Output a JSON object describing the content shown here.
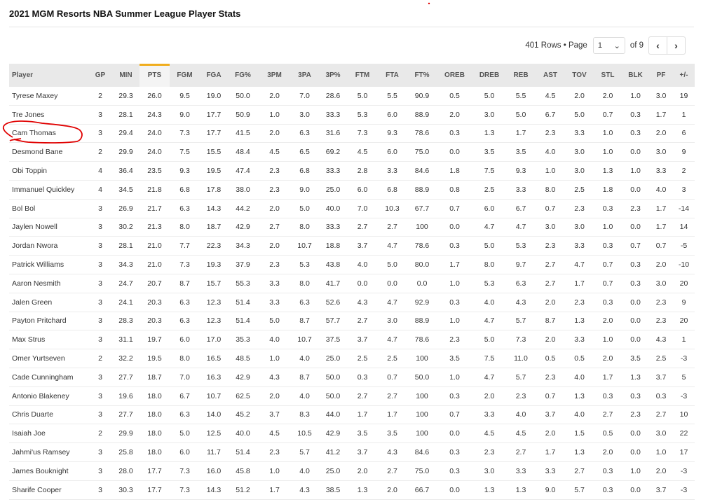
{
  "title": "2021 MGM Resorts NBA Summer League Player Stats",
  "pager": {
    "rows_label": "401 Rows • Page",
    "page": "1",
    "of_label": "of 9",
    "prev_icon": "chevron-left-icon",
    "next_icon": "chevron-right-icon"
  },
  "table": {
    "sorted_column": "PTS",
    "sort_color": "#f0ad1e",
    "highlight_color": "#e00000",
    "highlighted_player": "Cam Thomas",
    "columns": [
      "Player",
      "GP",
      "MIN",
      "PTS",
      "FGM",
      "FGA",
      "FG%",
      "3PM",
      "3PA",
      "3P%",
      "FTM",
      "FTA",
      "FT%",
      "OREB",
      "DREB",
      "REB",
      "AST",
      "TOV",
      "STL",
      "BLK",
      "PF",
      "+/-"
    ],
    "rows": [
      [
        "Tyrese Maxey",
        "2",
        "29.3",
        "26.0",
        "9.5",
        "19.0",
        "50.0",
        "2.0",
        "7.0",
        "28.6",
        "5.0",
        "5.5",
        "90.9",
        "0.5",
        "5.0",
        "5.5",
        "4.5",
        "2.0",
        "2.0",
        "1.0",
        "3.0",
        "19"
      ],
      [
        "Tre Jones",
        "3",
        "28.1",
        "24.3",
        "9.0",
        "17.7",
        "50.9",
        "1.0",
        "3.0",
        "33.3",
        "5.3",
        "6.0",
        "88.9",
        "2.0",
        "3.0",
        "5.0",
        "6.7",
        "5.0",
        "0.7",
        "0.3",
        "1.7",
        "1"
      ],
      [
        "Cam Thomas",
        "3",
        "29.4",
        "24.0",
        "7.3",
        "17.7",
        "41.5",
        "2.0",
        "6.3",
        "31.6",
        "7.3",
        "9.3",
        "78.6",
        "0.3",
        "1.3",
        "1.7",
        "2.3",
        "3.3",
        "1.0",
        "0.3",
        "2.0",
        "6"
      ],
      [
        "Desmond Bane",
        "2",
        "29.9",
        "24.0",
        "7.5",
        "15.5",
        "48.4",
        "4.5",
        "6.5",
        "69.2",
        "4.5",
        "6.0",
        "75.0",
        "0.0",
        "3.5",
        "3.5",
        "4.0",
        "3.0",
        "1.0",
        "0.0",
        "3.0",
        "9"
      ],
      [
        "Obi Toppin",
        "4",
        "36.4",
        "23.5",
        "9.3",
        "19.5",
        "47.4",
        "2.3",
        "6.8",
        "33.3",
        "2.8",
        "3.3",
        "84.6",
        "1.8",
        "7.5",
        "9.3",
        "1.0",
        "3.0",
        "1.3",
        "1.0",
        "3.3",
        "2"
      ],
      [
        "Immanuel Quickley",
        "4",
        "34.5",
        "21.8",
        "6.8",
        "17.8",
        "38.0",
        "2.3",
        "9.0",
        "25.0",
        "6.0",
        "6.8",
        "88.9",
        "0.8",
        "2.5",
        "3.3",
        "8.0",
        "2.5",
        "1.8",
        "0.0",
        "4.0",
        "3"
      ],
      [
        "Bol Bol",
        "3",
        "26.9",
        "21.7",
        "6.3",
        "14.3",
        "44.2",
        "2.0",
        "5.0",
        "40.0",
        "7.0",
        "10.3",
        "67.7",
        "0.7",
        "6.0",
        "6.7",
        "0.7",
        "2.3",
        "0.3",
        "2.3",
        "1.7",
        "-14"
      ],
      [
        "Jaylen Nowell",
        "3",
        "30.2",
        "21.3",
        "8.0",
        "18.7",
        "42.9",
        "2.7",
        "8.0",
        "33.3",
        "2.7",
        "2.7",
        "100",
        "0.0",
        "4.7",
        "4.7",
        "3.0",
        "3.0",
        "1.0",
        "0.0",
        "1.7",
        "14"
      ],
      [
        "Jordan Nwora",
        "3",
        "28.1",
        "21.0",
        "7.7",
        "22.3",
        "34.3",
        "2.0",
        "10.7",
        "18.8",
        "3.7",
        "4.7",
        "78.6",
        "0.3",
        "5.0",
        "5.3",
        "2.3",
        "3.3",
        "0.3",
        "0.7",
        "0.7",
        "-5"
      ],
      [
        "Patrick Williams",
        "3",
        "34.3",
        "21.0",
        "7.3",
        "19.3",
        "37.9",
        "2.3",
        "5.3",
        "43.8",
        "4.0",
        "5.0",
        "80.0",
        "1.7",
        "8.0",
        "9.7",
        "2.7",
        "4.7",
        "0.7",
        "0.3",
        "2.0",
        "-10"
      ],
      [
        "Aaron Nesmith",
        "3",
        "24.7",
        "20.7",
        "8.7",
        "15.7",
        "55.3",
        "3.3",
        "8.0",
        "41.7",
        "0.0",
        "0.0",
        "0.0",
        "1.0",
        "5.3",
        "6.3",
        "2.7",
        "1.7",
        "0.7",
        "0.3",
        "3.0",
        "20"
      ],
      [
        "Jalen Green",
        "3",
        "24.1",
        "20.3",
        "6.3",
        "12.3",
        "51.4",
        "3.3",
        "6.3",
        "52.6",
        "4.3",
        "4.7",
        "92.9",
        "0.3",
        "4.0",
        "4.3",
        "2.0",
        "2.3",
        "0.3",
        "0.0",
        "2.3",
        "9"
      ],
      [
        "Payton Pritchard",
        "3",
        "28.3",
        "20.3",
        "6.3",
        "12.3",
        "51.4",
        "5.0",
        "8.7",
        "57.7",
        "2.7",
        "3.0",
        "88.9",
        "1.0",
        "4.7",
        "5.7",
        "8.7",
        "1.3",
        "2.0",
        "0.0",
        "2.3",
        "20"
      ],
      [
        "Max Strus",
        "3",
        "31.1",
        "19.7",
        "6.0",
        "17.0",
        "35.3",
        "4.0",
        "10.7",
        "37.5",
        "3.7",
        "4.7",
        "78.6",
        "2.3",
        "5.0",
        "7.3",
        "2.0",
        "3.3",
        "1.0",
        "0.0",
        "4.3",
        "1"
      ],
      [
        "Omer Yurtseven",
        "2",
        "32.2",
        "19.5",
        "8.0",
        "16.5",
        "48.5",
        "1.0",
        "4.0",
        "25.0",
        "2.5",
        "2.5",
        "100",
        "3.5",
        "7.5",
        "11.0",
        "0.5",
        "0.5",
        "2.0",
        "3.5",
        "2.5",
        "-3"
      ],
      [
        "Cade Cunningham",
        "3",
        "27.7",
        "18.7",
        "7.0",
        "16.3",
        "42.9",
        "4.3",
        "8.7",
        "50.0",
        "0.3",
        "0.7",
        "50.0",
        "1.0",
        "4.7",
        "5.7",
        "2.3",
        "4.0",
        "1.7",
        "1.3",
        "3.7",
        "5"
      ],
      [
        "Antonio Blakeney",
        "3",
        "19.6",
        "18.0",
        "6.7",
        "10.7",
        "62.5",
        "2.0",
        "4.0",
        "50.0",
        "2.7",
        "2.7",
        "100",
        "0.3",
        "2.0",
        "2.3",
        "0.7",
        "1.3",
        "0.3",
        "0.3",
        "0.3",
        "-3"
      ],
      [
        "Chris Duarte",
        "3",
        "27.7",
        "18.0",
        "6.3",
        "14.0",
        "45.2",
        "3.7",
        "8.3",
        "44.0",
        "1.7",
        "1.7",
        "100",
        "0.7",
        "3.3",
        "4.0",
        "3.7",
        "4.0",
        "2.7",
        "2.3",
        "2.7",
        "10"
      ],
      [
        "Isaiah Joe",
        "2",
        "29.9",
        "18.0",
        "5.0",
        "12.5",
        "40.0",
        "4.5",
        "10.5",
        "42.9",
        "3.5",
        "3.5",
        "100",
        "0.0",
        "4.5",
        "4.5",
        "2.0",
        "1.5",
        "0.5",
        "0.0",
        "3.0",
        "22"
      ],
      [
        "Jahmi'us Ramsey",
        "3",
        "25.8",
        "18.0",
        "6.0",
        "11.7",
        "51.4",
        "2.3",
        "5.7",
        "41.2",
        "3.7",
        "4.3",
        "84.6",
        "0.3",
        "2.3",
        "2.7",
        "1.7",
        "1.3",
        "2.0",
        "0.0",
        "1.0",
        "17"
      ],
      [
        "James Bouknight",
        "3",
        "28.0",
        "17.7",
        "7.3",
        "16.0",
        "45.8",
        "1.0",
        "4.0",
        "25.0",
        "2.0",
        "2.7",
        "75.0",
        "0.3",
        "3.0",
        "3.3",
        "3.3",
        "2.7",
        "0.3",
        "1.0",
        "2.0",
        "-3"
      ],
      [
        "Sharife Cooper",
        "3",
        "30.3",
        "17.7",
        "7.3",
        "14.3",
        "51.2",
        "1.7",
        "4.3",
        "38.5",
        "1.3",
        "2.0",
        "66.7",
        "0.0",
        "1.3",
        "1.3",
        "9.0",
        "5.7",
        "0.3",
        "0.0",
        "3.7",
        "-3"
      ]
    ]
  }
}
